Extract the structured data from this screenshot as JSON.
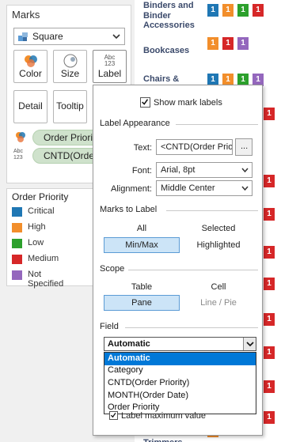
{
  "marks": {
    "title": "Marks",
    "mark_type": "Square",
    "buttons": {
      "color": "Color",
      "size": "Size",
      "label": "Label",
      "label_icon": "Abc\n123",
      "detail": "Detail",
      "tooltip": "Tooltip"
    },
    "pills": [
      {
        "text": "Order Priority",
        "icon": "color-icon"
      },
      {
        "text": "CNTD(Order P",
        "icon": "abc-123-icon",
        "icon_text": "Abc\n123"
      }
    ]
  },
  "legend": {
    "title": "Order Priority",
    "items": [
      {
        "label": "Critical",
        "color": "#1f77b4"
      },
      {
        "label": "High",
        "color": "#f28e2b"
      },
      {
        "label": "Low",
        "color": "#2ca02c"
      },
      {
        "label": "Medium",
        "color": "#d62728"
      },
      {
        "label": "Not Specified",
        "color": "#9467bd"
      }
    ]
  },
  "viz": {
    "rows": [
      {
        "label": "Binders and Binder Accessories",
        "marks": [
          {
            "v": "1",
            "c": "#1f77b4"
          },
          {
            "v": "1",
            "c": "#f28e2b"
          },
          {
            "v": "1",
            "c": "#2ca02c"
          },
          {
            "v": "1",
            "c": "#d62728"
          }
        ]
      },
      {
        "label": "Bookcases",
        "marks": [
          {
            "v": "1",
            "c": "#f28e2b"
          },
          {
            "v": "1",
            "c": "#d62728"
          },
          {
            "v": "1",
            "c": "#9467bd"
          }
        ]
      },
      {
        "label": "Chairs &",
        "marks": [
          {
            "v": "1",
            "c": "#1f77b4"
          },
          {
            "v": "1",
            "c": "#f28e2b"
          },
          {
            "v": "1",
            "c": "#2ca02c"
          },
          {
            "v": "1",
            "c": "#9467bd"
          }
        ]
      },
      {
        "label": "Rulers and Trimmers",
        "marks": [
          {
            "v": "1",
            "c": "#f28e2b"
          }
        ]
      }
    ],
    "side_marks": [
      {
        "v": "1",
        "c": "#d62728"
      },
      {
        "v": "1",
        "c": "#d62728"
      },
      {
        "v": "1",
        "c": "#d62728"
      },
      {
        "v": "1",
        "c": "#d62728"
      },
      {
        "v": "1",
        "c": "#d62728"
      },
      {
        "v": "1",
        "c": "#d62728"
      },
      {
        "v": "1",
        "c": "#d62728"
      },
      {
        "v": "1",
        "c": "#d62728"
      },
      {
        "v": "1",
        "c": "#d62728"
      }
    ]
  },
  "popup": {
    "show_labels": "Show mark labels",
    "appearance_title": "Label Appearance",
    "text_label": "Text:",
    "text_value": "<CNTD(Order Prior",
    "text_button": "...",
    "font_label": "Font:",
    "font_value": "Arial, 8pt",
    "alignment_label": "Alignment:",
    "alignment_value": "Middle Center",
    "marks_title": "Marks to Label",
    "marks_all": "All",
    "marks_selected": "Selected",
    "marks_minmax": "Min/Max",
    "marks_highlighted": "Highlighted",
    "scope_title": "Scope",
    "scope_table": "Table",
    "scope_cell": "Cell",
    "scope_pane": "Pane",
    "scope_line": "Line / Pie",
    "field_title": "Field",
    "field_value": "Automatic",
    "field_options": [
      "Automatic",
      "Category",
      "CNTD(Order Priority)",
      "MONTH(Order Date)",
      "Order Priority"
    ],
    "label_max": "Label maximum value"
  },
  "colors": {
    "selection": "#cce4f7",
    "highlight": "#0078d7",
    "pill": "#cfe2cc"
  }
}
